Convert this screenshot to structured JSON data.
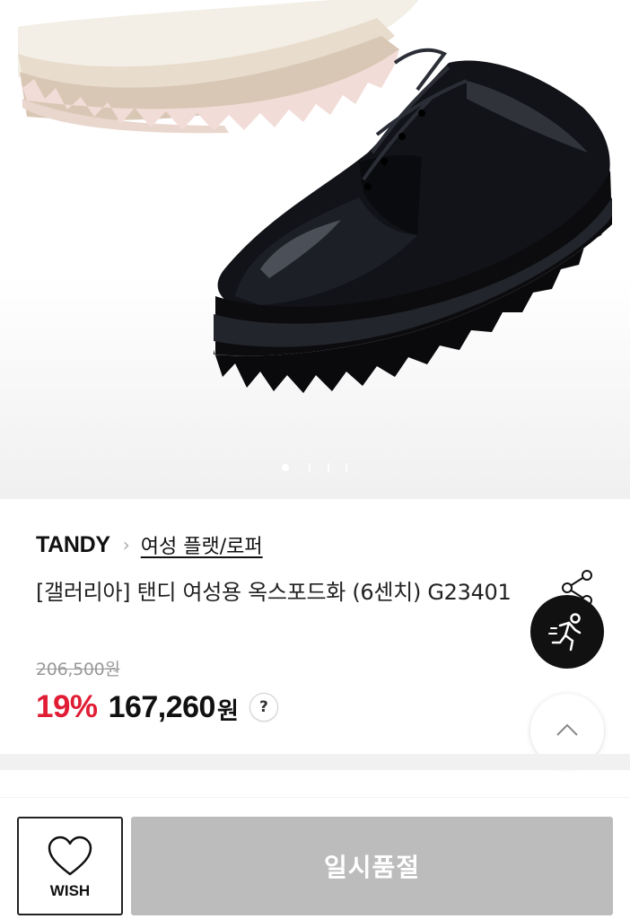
{
  "product": {
    "brand": "TANDY",
    "category": "여성 플랫/로퍼",
    "title": "[갤러리아] 탠디 여성용 옥스포드화 (6센치) G23401",
    "original_price": "206,500원",
    "discount": "19%",
    "price": "167,260",
    "currency": "원",
    "price_help": "?"
  },
  "carousel": {
    "total_slides": 4,
    "active_index": 0,
    "images": [
      "cream-platform-shoe",
      "black-patent-oxford-shoe"
    ]
  },
  "actions": {
    "wish_label": "WISH",
    "soldout_label": "일시품절"
  },
  "icons": {
    "breadcrumb_separator": "chevron-right-icon",
    "share": "share-icon",
    "running": "running-person-icon",
    "scroll_top": "chevron-up-icon",
    "wish": "heart-outline-icon"
  },
  "colors": {
    "discount": "#e11d35",
    "soldout_bg": "#bcbcbc",
    "dark_button": "#111111"
  }
}
